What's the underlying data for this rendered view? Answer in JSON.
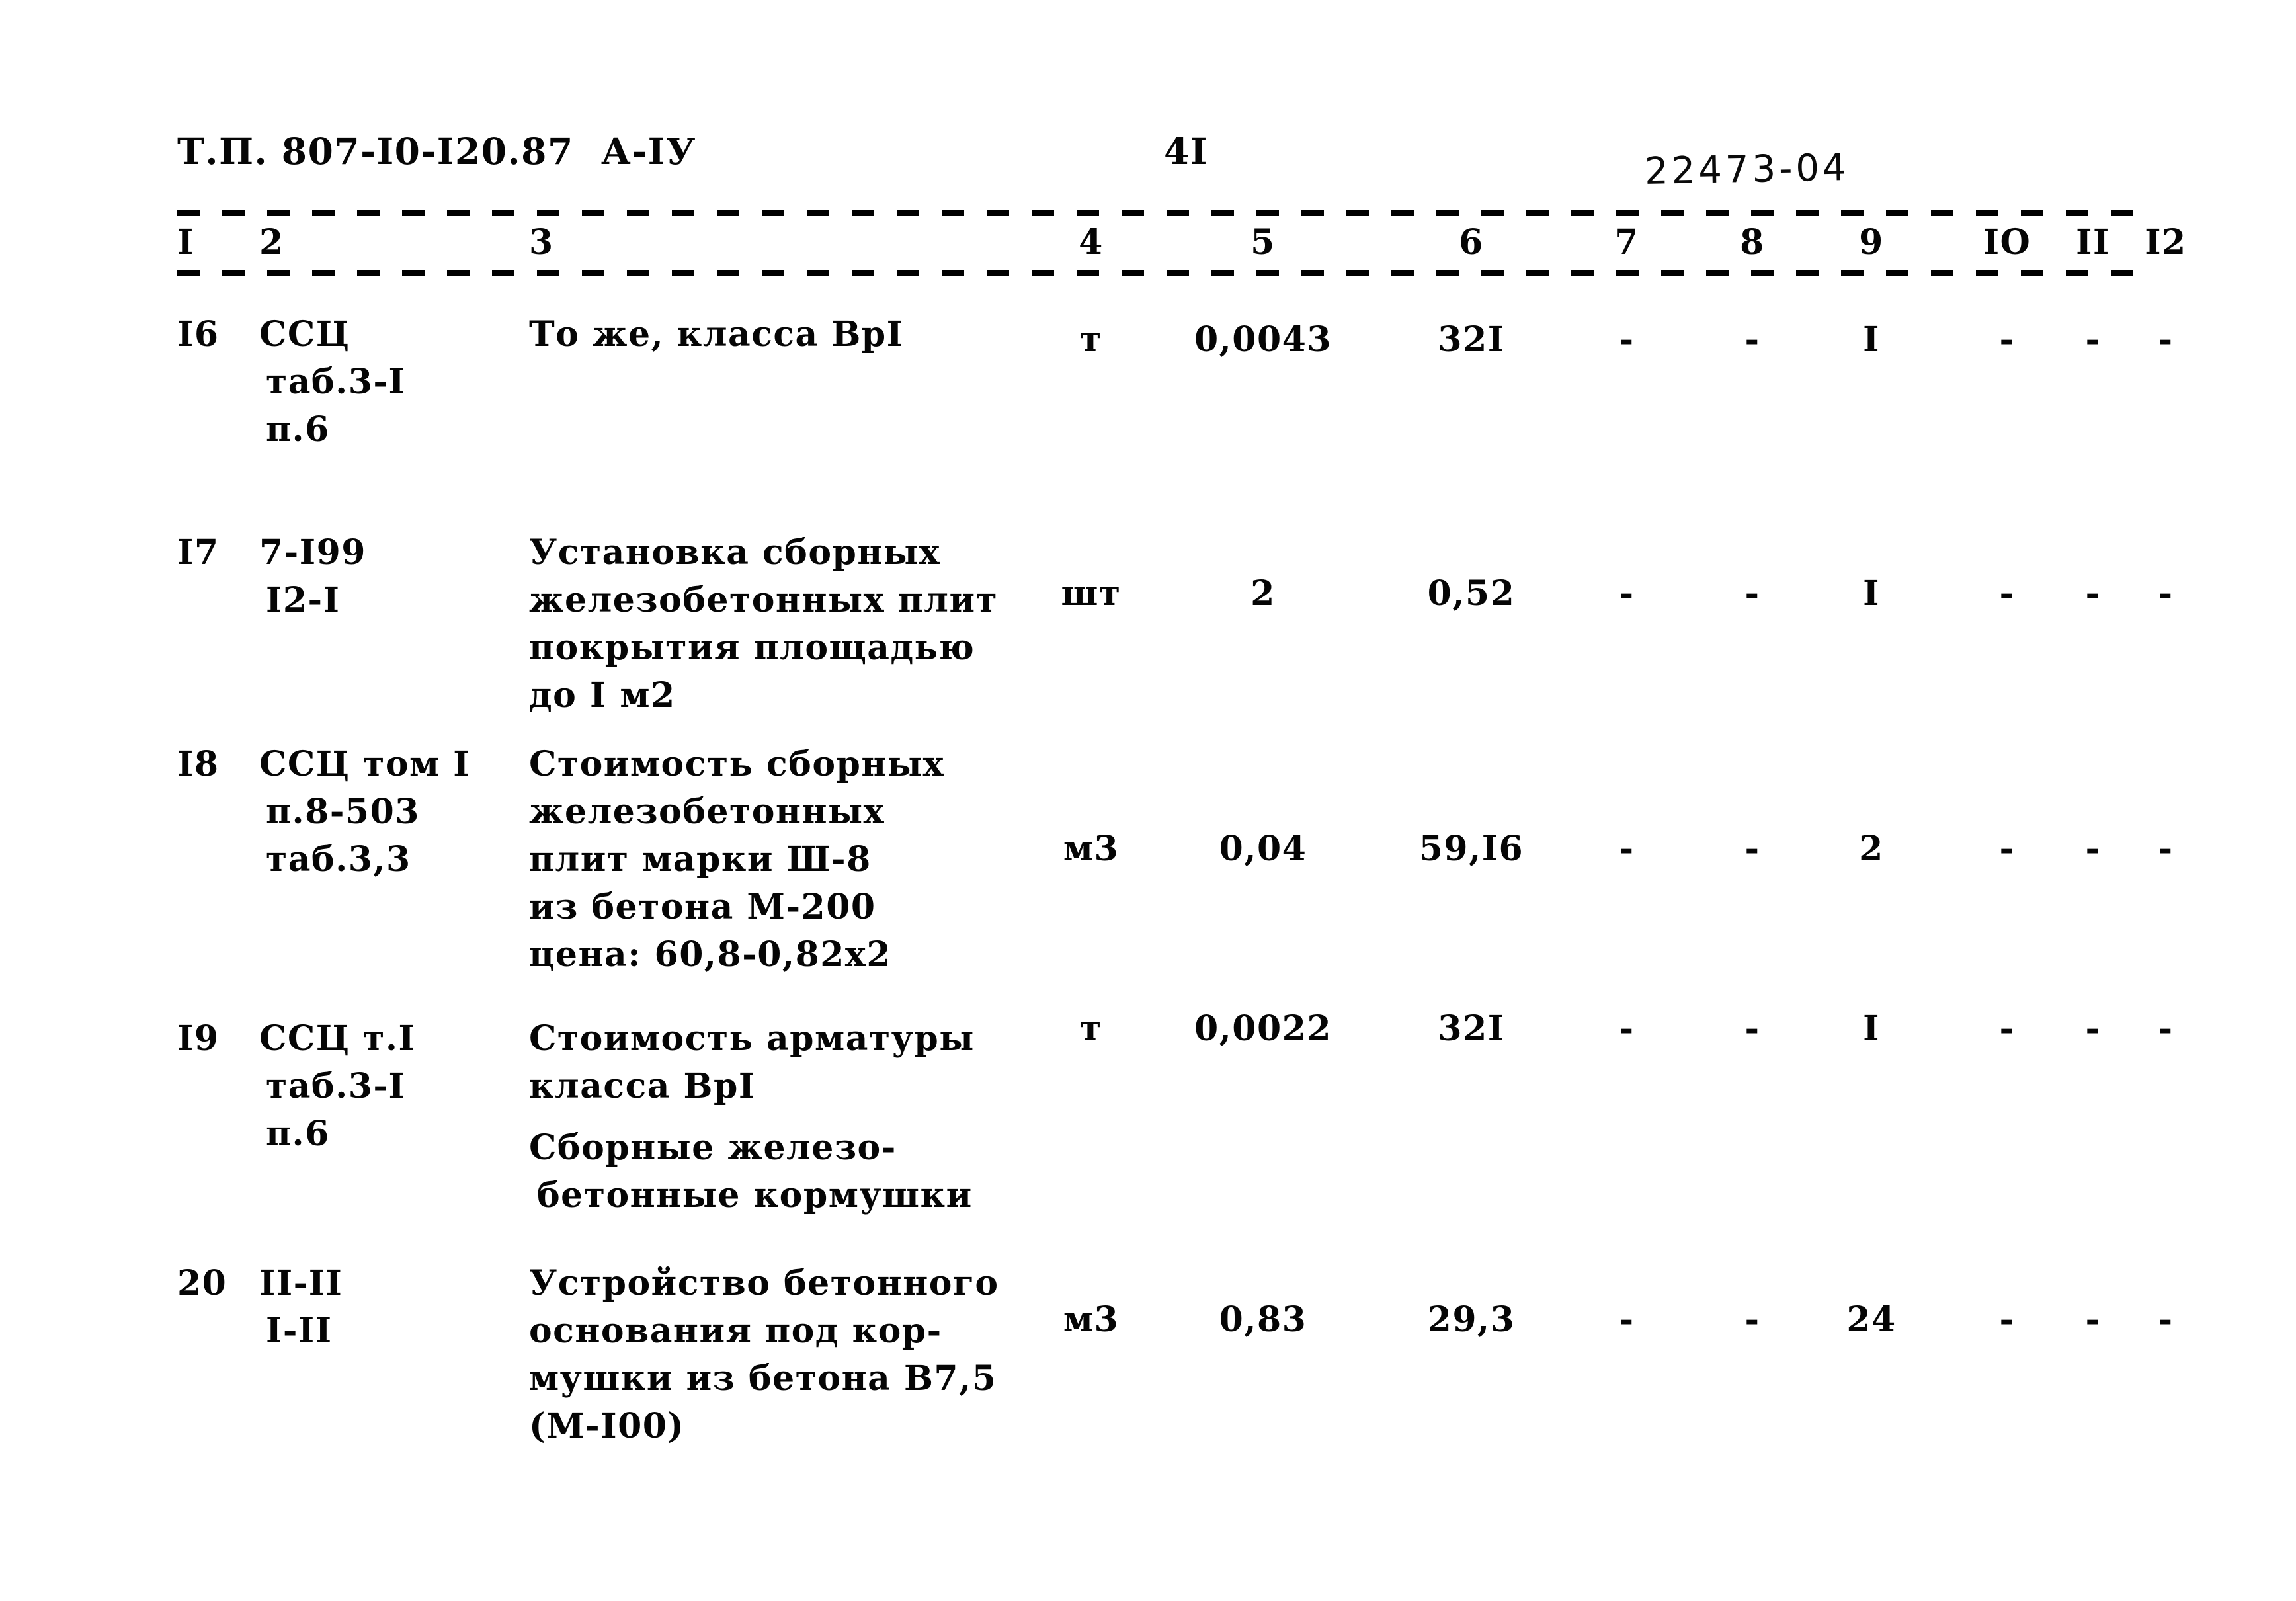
{
  "header": {
    "doc_code": "Т.П. 807-I0-I20.87  А-IУ",
    "page_number": "4I",
    "archive_stamp": "22473-04"
  },
  "table": {
    "column_headers": [
      "I",
      "2",
      "3",
      "4",
      "5",
      "6",
      "7",
      "8",
      "9",
      "IO",
      "II",
      "I2"
    ],
    "rows": [
      {
        "pos": "I6",
        "code_lines": [
          "ССЦ",
          "таб.3-I",
          "п.6"
        ],
        "name_lines": [
          "То же, класса ВрI"
        ],
        "unit": "т",
        "qty": "0,0043",
        "price": "32I",
        "c7": "-",
        "c8": "-",
        "c9": "I",
        "c10": "-",
        "c11": "-",
        "c12": "-"
      },
      {
        "pos": "I7",
        "code_lines": [
          "7-I99",
          "I2-I"
        ],
        "name_lines": [
          "Установка сборных",
          "железобетонных плит",
          "покрытия площадью",
          "до I м2"
        ],
        "unit": "шт",
        "qty": "2",
        "price": "0,52",
        "c7": "-",
        "c8": "-",
        "c9": "I",
        "c10": "-",
        "c11": "-",
        "c12": "-"
      },
      {
        "pos": "I8",
        "code_lines": [
          "ССЦ том I",
          "п.8-503",
          "таб.3,3"
        ],
        "name_lines": [
          "Стоимость сборных",
          "железобетонных",
          "плит марки Ш-8",
          "из бетона М-200",
          "цена: 60,8-0,82х2"
        ],
        "unit": "м3",
        "qty": "0,04",
        "price": "59,I6",
        "c7": "-",
        "c8": "-",
        "c9": "2",
        "c10": "-",
        "c11": "-",
        "c12": "-"
      },
      {
        "pos": "I9",
        "code_lines": [
          "ССЦ т.I",
          "таб.3-I",
          "п.6"
        ],
        "name_lines": [
          "Стоимость арматуры",
          "класса ВрI"
        ],
        "unit": "т",
        "qty": "0,0022",
        "price": "32I",
        "c7": "-",
        "c8": "-",
        "c9": "I",
        "c10": "-",
        "c11": "-",
        "c12": "-"
      },
      {
        "pos": "20",
        "code_lines": [
          "II-II",
          "I-II"
        ],
        "name_lines": [
          "Устройство бетонного",
          "основания под кор-",
          "мушки из бетона В7,5",
          "(М-I00)"
        ],
        "unit": "м3",
        "qty": "0,83",
        "price": "29,3",
        "c7": "-",
        "c8": "-",
        "c9": "24",
        "c10": "-",
        "c11": "-",
        "c12": "-"
      }
    ],
    "section_note": {
      "lines": [
        "Сборные железо-",
        "бетонные кормушки"
      ]
    }
  }
}
